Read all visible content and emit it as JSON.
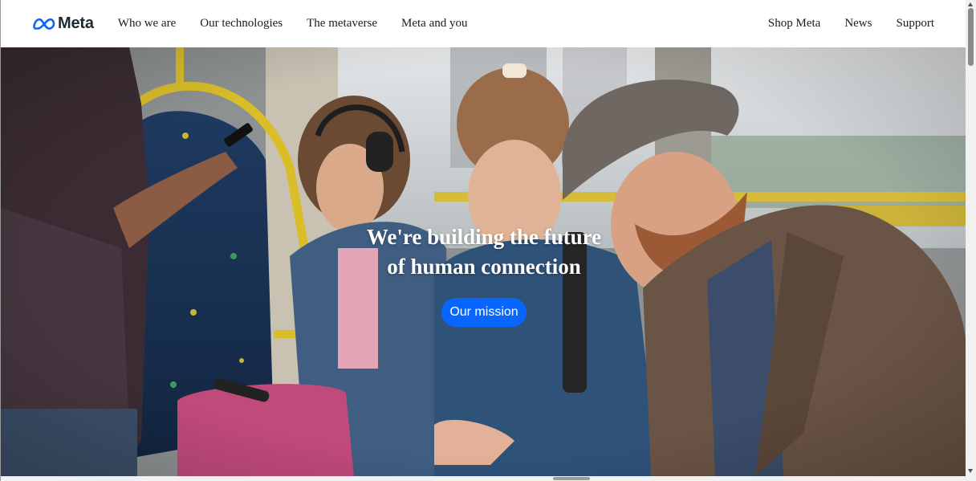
{
  "brand": {
    "logo_text": "Meta",
    "logo_color": "#0866ff"
  },
  "nav": {
    "left_links": [
      "Who we are",
      "Our technologies",
      "The metaverse",
      "Meta and you"
    ],
    "right_links": [
      "Shop Meta",
      "News",
      "Support"
    ]
  },
  "hero": {
    "title": "We're building the future of human connection",
    "cta_label": "Our mission",
    "cta_color": "#0866ff",
    "image_description_icon": "photo-people-on-bus"
  }
}
